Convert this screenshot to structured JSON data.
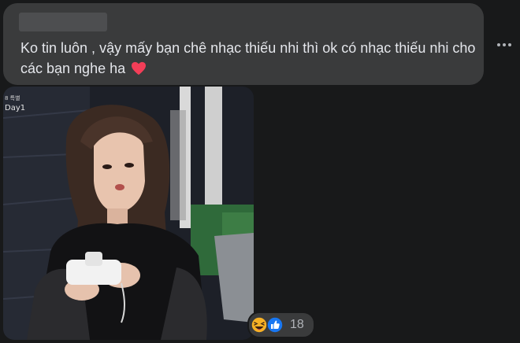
{
  "comment": {
    "text": "Ko tin luôn , vậy mấy bạn chê nhạc thiếu nhi thì ok có nhạc thiếu nhi cho các bạn nghe ha",
    "emoji": "heart-icon"
  },
  "photo": {
    "tag_small": "8 특별",
    "tag": "Day1"
  },
  "reactions": {
    "icons": [
      "haha-icon",
      "like-icon"
    ],
    "count": "18"
  },
  "colors": {
    "background": "#18191a",
    "bubble": "#3a3b3c",
    "text": "#e4e6eb",
    "muted": "#b0b3b8",
    "heart": "#f33e58",
    "like": "#1877f2",
    "haha": "#f7b125"
  }
}
